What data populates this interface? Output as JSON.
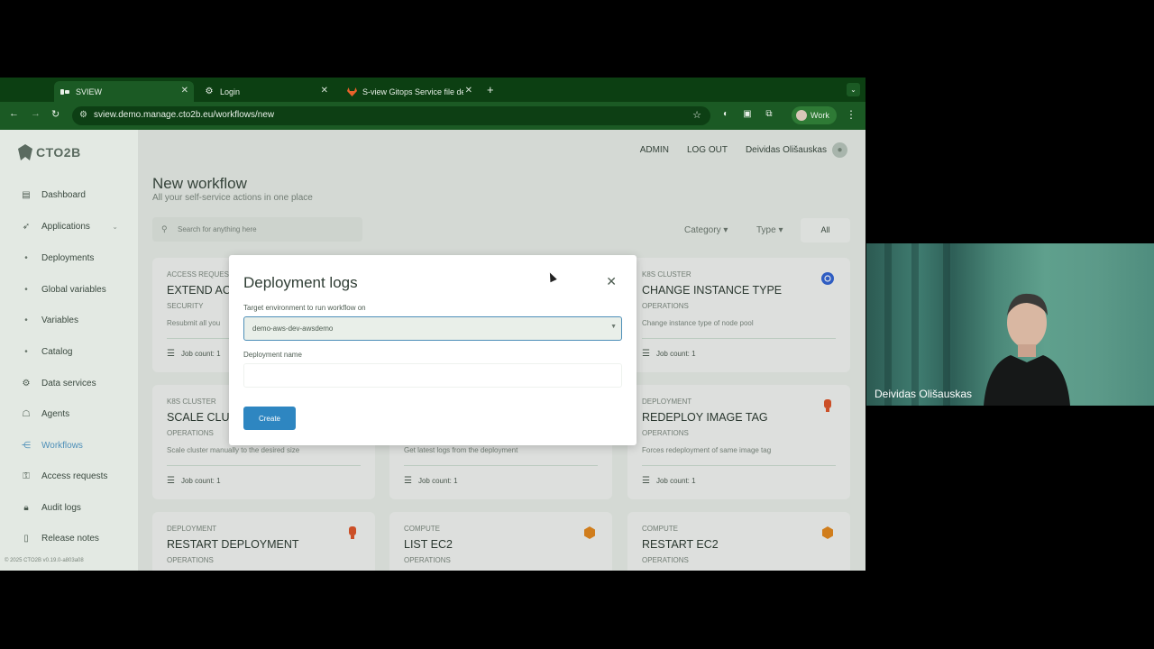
{
  "tabs": [
    {
      "title": "SVIEW",
      "icon": "sview-favicon-icon",
      "active": true
    },
    {
      "title": "Login",
      "icon": "gear-icon",
      "active": false
    },
    {
      "title": "S-view Gitops Service file de",
      "icon": "gitlab-icon",
      "active": false
    }
  ],
  "url": "sview.demo.manage.cto2b.eu/workflows/new",
  "profile_label": "Work",
  "logo_text": "CTO2B",
  "sidebar": {
    "items": [
      {
        "label": "Dashboard",
        "icon": "dashboard-icon"
      },
      {
        "label": "Applications",
        "icon": "rocket-icon"
      },
      {
        "label": "Deployments",
        "icon": "bullet"
      },
      {
        "label": "Global variables",
        "icon": "bullet"
      },
      {
        "label": "Variables",
        "icon": "bullet"
      },
      {
        "label": "Catalog",
        "icon": "bullet"
      },
      {
        "label": "Data services",
        "icon": "gear-icon"
      },
      {
        "label": "Agents",
        "icon": "agent-icon"
      },
      {
        "label": "Workflows",
        "icon": "workflow-icon"
      },
      {
        "label": "Access requests",
        "icon": "key-icon"
      },
      {
        "label": "Audit logs",
        "icon": "lock-icon"
      },
      {
        "label": "Release notes",
        "icon": "notes-icon"
      }
    ],
    "footer": "© 2025 CTO2B v0.19.0-a803a08"
  },
  "topnav": {
    "admin": "ADMIN",
    "logout": "LOG OUT",
    "user": "Deividas Olišauskas"
  },
  "page": {
    "title": "New workflow",
    "subtitle": "All your self-service actions in one place",
    "search_placeholder": "Search for anything here",
    "filter_category": "Category",
    "filter_type": "Type",
    "filter_all": "All"
  },
  "cards": [
    {
      "category": "ACCESS REQUES",
      "title": "EXTEND AC",
      "team": "SECURITY",
      "desc": "Resubmit all you",
      "jobs": "Job count: 1",
      "icon": ""
    },
    {
      "category": "K8S CLUSTER",
      "title": "CHANGE INSTANCE TYPE",
      "team": "OPERATIONS",
      "desc": "Change instance type of node pool",
      "jobs": "Job count: 1",
      "icon": "kubernetes-icon"
    },
    {
      "category": "K8S CLUSTER",
      "title": "SCALE CLU",
      "team": "OPERATIONS",
      "desc": "Scale cluster manually to the desired size",
      "jobs": "Job count: 1",
      "icon": ""
    },
    {
      "category": "",
      "title": "",
      "team": "",
      "desc": "Get latest logs from the deployment",
      "jobs": "Job count: 1",
      "icon": ""
    },
    {
      "category": "DEPLOYMENT",
      "title": "REDEPLOY IMAGE TAG",
      "team": "OPERATIONS",
      "desc": "Forces redeployment of same image tag",
      "jobs": "Job count: 1",
      "icon": "deployment-icon"
    },
    {
      "category": "DEPLOYMENT",
      "title": "RESTART DEPLOYMENT",
      "team": "OPERATIONS",
      "desc": "",
      "jobs": "",
      "icon": "deployment-icon"
    },
    {
      "category": "COMPUTE",
      "title": "LIST EC2",
      "team": "OPERATIONS",
      "desc": "",
      "jobs": "",
      "icon": "ec2-icon"
    },
    {
      "category": "COMPUTE",
      "title": "RESTART EC2",
      "team": "OPERATIONS",
      "desc": "",
      "jobs": "",
      "icon": "ec2-icon"
    }
  ],
  "modal": {
    "title": "Deployment logs",
    "env_label": "Target environment to run workflow on",
    "env_value": "demo-aws-dev-awsdemo",
    "name_label": "Deployment name",
    "name_value": "",
    "create_label": "Create"
  },
  "webcam": {
    "name": "Deividas Olišauskas"
  },
  "colors": {
    "accent": "#2e86c1",
    "browser_frame": "#1b5a24",
    "active_nav": "#4d8fb8"
  }
}
